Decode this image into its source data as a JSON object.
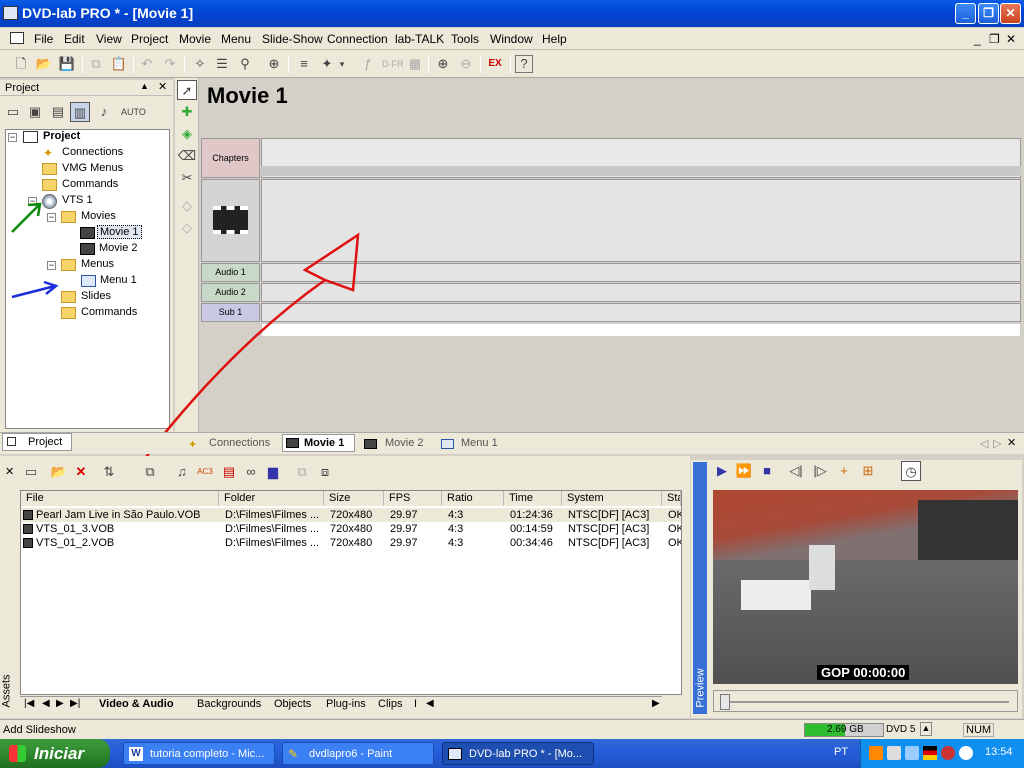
{
  "window": {
    "title": "DVD-lab PRO * - [Movie 1]"
  },
  "menu": [
    "File",
    "Edit",
    "View",
    "Project",
    "Movie",
    "Menu",
    "Slide-Show",
    "Connection",
    "lab-TALK",
    "Tools",
    "Window",
    "Help"
  ],
  "project_panel": {
    "title": "Project",
    "tab": "Project",
    "tree": {
      "root": "Project",
      "connections": "Connections",
      "vmg_menus": "VMG Menus",
      "commands": "Commands",
      "vts": "VTS 1",
      "movies": "Movies",
      "movie1": "Movie 1",
      "movie2": "Movie 2",
      "menus": "Menus",
      "menu1": "Menu 1",
      "slides": "Slides",
      "commands2": "Commands"
    }
  },
  "movie": {
    "title": "Movie 1",
    "tracks": {
      "chapters": "Chapters",
      "audio1": "Audio 1",
      "audio2": "Audio 2",
      "sub1": "Sub 1"
    }
  },
  "doc_tabs": [
    "Connections",
    "Movie 1",
    "Movie 2",
    "Menu 1"
  ],
  "assets": {
    "side_label": "Assets",
    "columns": [
      "File",
      "Folder",
      "Size",
      "FPS",
      "Ratio",
      "Time",
      "System",
      "Sta"
    ],
    "rows": [
      {
        "file": "Pearl Jam Live in São Paulo.VOB",
        "folder": "D:\\Filmes\\Filmes ...",
        "size": "720x480",
        "fps": "29.97",
        "ratio": "4:3",
        "time": "01:24:36",
        "system": "NTSC[DF] [AC3]",
        "status": "OK"
      },
      {
        "file": "VTS_01_3.VOB",
        "folder": "D:\\Filmes\\Filmes ...",
        "size": "720x480",
        "fps": "29.97",
        "ratio": "4:3",
        "time": "00:14:59",
        "system": "NTSC[DF] [AC3]",
        "status": "OK"
      },
      {
        "file": "VTS_01_2.VOB",
        "folder": "D:\\Filmes\\Filmes ...",
        "size": "720x480",
        "fps": "29.97",
        "ratio": "4:3",
        "time": "00:34:46",
        "system": "NTSC[DF] [AC3]",
        "status": "OK"
      }
    ],
    "tabs": [
      "Video & Audio",
      "Backgrounds",
      "Objects",
      "Plug-ins",
      "Clips",
      "I"
    ]
  },
  "preview": {
    "side_label": "Preview",
    "gop": "GOP 00:00:00"
  },
  "status": {
    "text": "Add Slideshow",
    "disk": "2.69 GB",
    "dvd": "DVD 5",
    "num": "NUM"
  },
  "taskbar": {
    "start": "Iniciar",
    "tasks": [
      "tutoria completo - Mic...",
      "dvdlapro6 - Paint",
      "DVD-lab PRO * - [Mo..."
    ],
    "lang": "PT",
    "clock": "13:54"
  }
}
